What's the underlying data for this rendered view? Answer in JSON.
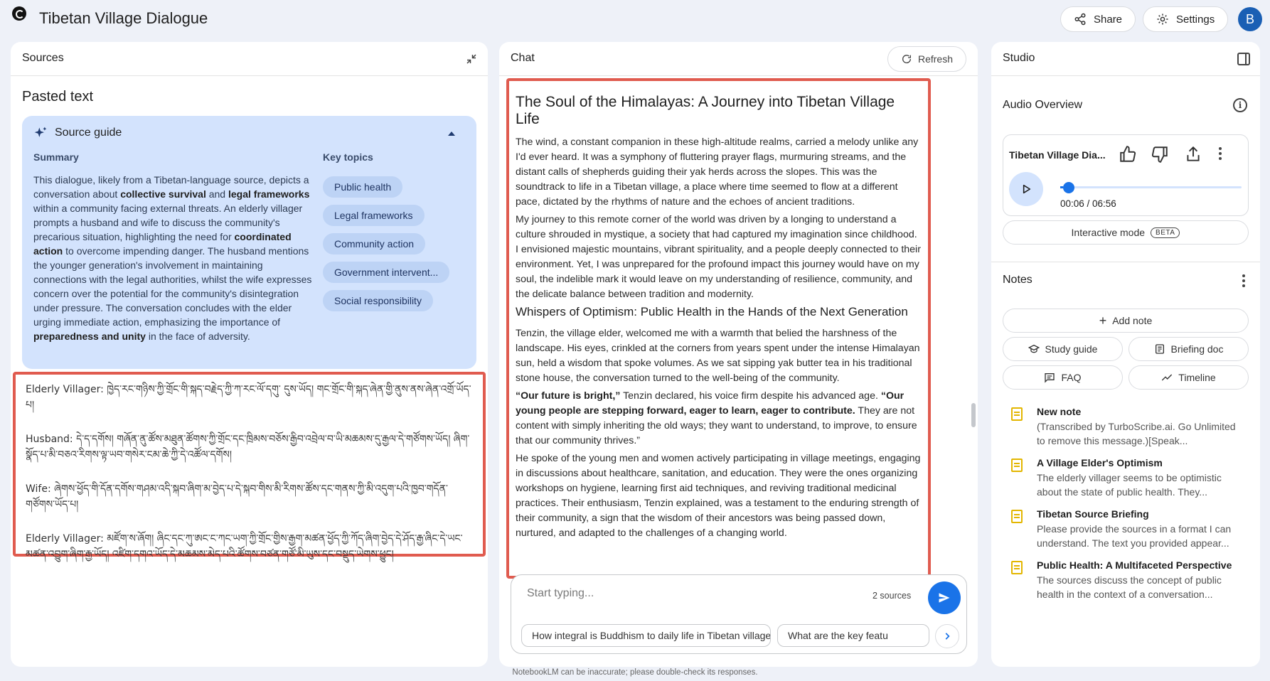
{
  "app": {
    "title": "Tibetan Village Dialogue",
    "avatar_letter": "B"
  },
  "header": {
    "share_label": "Share",
    "settings_label": "Settings"
  },
  "sources": {
    "panel_title": "Sources",
    "pasted_title": "Pasted text",
    "guide": {
      "title": "Source guide",
      "summary_label": "Summary",
      "summary_parts": [
        "This dialogue, likely from a Tibetan-language source, depicts a conversation about ",
        "collective survival",
        " and ",
        "legal frameworks",
        " within a community facing external threats. An elderly villager prompts a husband and wife to discuss the community's precarious situation, highlighting the need for ",
        "coordinated action",
        " to overcome impending danger. The husband mentions the younger generation's involvement in maintaining connections with the legal authorities, whilst the wife expresses concern over the potential for the community's disintegration under pressure. The conversation concludes with the elder urging immediate action, emphasizing the importance of ",
        "preparedness and unity",
        " in the face of adversity."
      ],
      "topics_label": "Key topics",
      "topics": [
        "Public health",
        "Legal frameworks",
        "Community action",
        "Government intervent...",
        "Social responsibility"
      ]
    },
    "dialogue": [
      "Elderly Villager: ཁྱེད་རང་གཉིས་ཀྱི་གྲོང་གི་སྐད་བརྗེད་ཀྱི་ཀ་རང་ལོ་དགུ་ དུས་ཡོད། གང་གྲོང་གི་སྐད་ཞེན་གྱི་ནུས་ནས་ཞེན་འགྲོ་ཡོད་པ།",
      "Husband: དེ་ད་དགོས། གཞོན་ནུ་ཚོས་མཐུན་ཚོགས་ཀྱི་གྲོང་དང་ཁྲིམས་བཅོས་རྒྱིབ་འབྲེལ་བ་ཡི་མཆམས་དུ་རྒྱལ་དེ་གཙོགས་ཡོད། ཞིག་སྣོད་པ་མི་བཅའ་རིགས་ལྟ་ཡབ་གསེར་ངམ་ཆེ་ཀྱི་དེ་འཚོལ་དགོས།",
      "Wife: ཞེགས་ཕྱོད་གི་དོན་དགོས་གཤམ་འདི་སྐབ་ཞིག་མ་བྱེད་པ་དེ་སྐབ་གིས་མི་རིགས་ཚོས་དང་གནས་ཀྱི་མི་འདུག་པའི་ཁྱབ་གདོན་གཙོགས་ཡོད་པ།",
      "Elderly Villager: མཛོག་ས་ཞོག། ཞིང་དང་ཀུ་ཨང་ང་ཀང་ཡག་ཀྱི་གྲོང་གྱིས་རྒྱག་མཚན་ཕྱོད་ཀྱི་ཀོད་ཞིག་བྱེད་དེ་ཤོད་རྒྱ་ཞིང་དེ་ཡང་མཚན་འབྱུག་ཞིག་རྒྱ་ཡོད། འཛིག་དགའ་ཡོད་དེ་མཆམས་མེད་པའི་ཚོགས་བཙན་གཙོ་མི་ཡུས་དང་བསྡུད་ཡེགས་ཕྱུང།"
    ]
  },
  "chat": {
    "panel_title": "Chat",
    "refresh_label": "Refresh",
    "heading": "The Soul of the Himalayas: A Journey into Tibetan Village Life",
    "p1": "The wind, a constant companion in these high-altitude realms, carried a melody unlike any I'd ever heard. It was a symphony of fluttering prayer flags, murmuring streams, and the distant calls of shepherds guiding their yak herds across the slopes. This was the soundtrack to life in a Tibetan village, a place where time seemed to flow at a different pace, dictated by the rhythms of nature and the echoes of ancient traditions.",
    "p2": "My journey to this remote corner of the world was driven by a longing to understand a culture shrouded in mystique, a society that had captured my imagination since childhood. I envisioned majestic mountains, vibrant spirituality, and a people deeply connected to their environment. Yet, I was unprepared for the profound impact this journey would have on my soul, the indelible mark it would leave on my understanding of resilience, community, and the delicate balance between tradition and modernity.",
    "subheading": "Whispers of Optimism: Public Health in the Hands of the Next Generation",
    "p3": "Tenzin, the village elder, welcomed me with a warmth that belied the harshness of the landscape. His eyes, crinkled at the corners from years spent under the intense Himalayan sun, held a wisdom that spoke volumes. As we sat sipping yak butter tea in his traditional stone house, the conversation turned to the well-being of the community.",
    "quote_bold1": "“Our future is bright,”",
    "quote_mid": " Tenzin declared, his voice firm despite his advanced age. ",
    "quote_bold2": "“Our young people are stepping forward, eager to learn, eager to contribute.",
    "quote_end": " They are not content with simply inheriting the old ways; they want to understand, to improve, to ensure that our community thrives.”",
    "p5": "He spoke of the young men and women actively participating in village meetings, engaging in discussions about healthcare, sanitation, and education. They were the ones organizing workshops on hygiene, learning first aid techniques, and reviving traditional medicinal practices. Their enthusiasm, Tenzin explained, was a testament to the enduring strength of their community, a sign that the wisdom of their ancestors was being passed down, nurtured, and adapted to the challenges of a changing world.",
    "composer_placeholder": "Start typing...",
    "source_count": "2 sources",
    "suggestions": [
      "How integral is Buddhism to daily life in Tibetan villages?",
      "What are the key featu"
    ]
  },
  "studio": {
    "panel_title": "Studio",
    "audio_title": "Audio Overview",
    "audio_name": "Tibetan Village Dia...",
    "time": "00:06 / 06:56",
    "progress": 0.015,
    "interactive_label": "Interactive mode",
    "beta_label": "BETA",
    "notes_title": "Notes",
    "add_note_label": "Add note",
    "buttons": [
      "Study guide",
      "Briefing doc",
      "FAQ",
      "Timeline"
    ],
    "notes": [
      {
        "title": "New note",
        "body": "(Transcribed by TurboScribe.ai. Go Unlimited to remove this message.)[Speak..."
      },
      {
        "title": "A Village Elder's Optimism",
        "body": "The elderly villager seems to be optimistic about the state of public health. They..."
      },
      {
        "title": "Tibetan Source Briefing",
        "body": "Please provide the sources in a format I can understand. The text you provided appear..."
      },
      {
        "title": "Public Health: A Multifaceted Perspective",
        "body": "The sources discuss the concept of public health in the context of a conversation..."
      }
    ]
  },
  "footer": {
    "disclaimer": "NotebookLM can be inaccurate; please double-check its responses."
  }
}
